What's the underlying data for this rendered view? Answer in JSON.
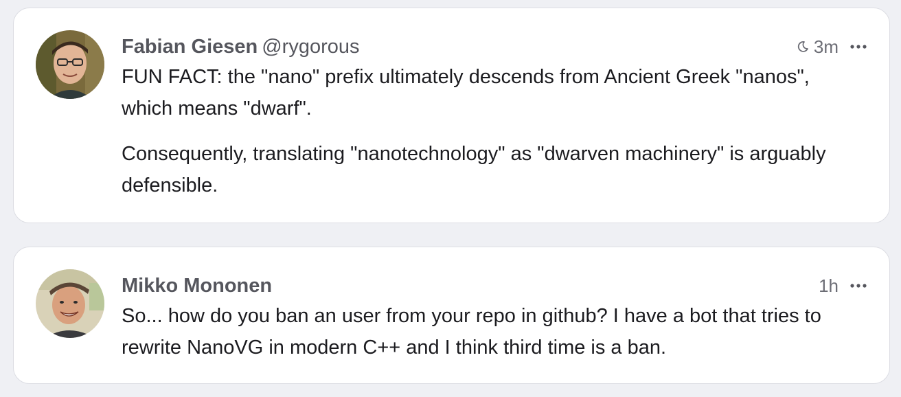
{
  "posts": [
    {
      "author_name": "Fabian Giesen",
      "author_handle": "@rygorous",
      "time": "3m",
      "visibility_icon": "moon-icon",
      "paragraphs": [
        "FUN FACT: the \"nano\" prefix ultimately descends from Ancient Greek \"nanos\", which means \"dwarf\".",
        "Consequently, translating \"nanotechnology\" as \"dwarven machinery\" is arguably defensible."
      ]
    },
    {
      "author_name": "Mikko Mononen",
      "author_handle": "",
      "time": "1h",
      "paragraphs": [
        "So... how do you ban an user from your repo in github? I have a bot that tries to rewrite NanoVG in modern C++ and I think third time is a ban."
      ]
    }
  ],
  "colors": {
    "background": "#eff0f4",
    "card": "#ffffff",
    "text": "#1b1b1f",
    "muted": "#6c6d75"
  }
}
